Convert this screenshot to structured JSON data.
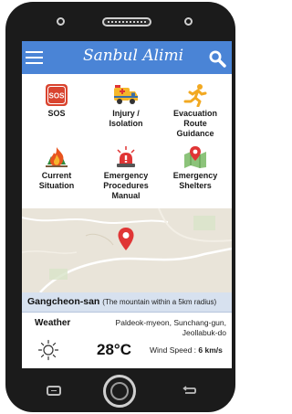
{
  "app": {
    "title": "Sanbul Alimi"
  },
  "icons": {
    "menu": "hamburger-menu-icon",
    "search": "search-icon"
  },
  "menu_tiles": [
    {
      "label_lines": [
        "SOS"
      ],
      "icon": "sos-icon"
    },
    {
      "label_lines": [
        "Injury /",
        "Isolation"
      ],
      "icon": "ambulance-icon"
    },
    {
      "label_lines": [
        "Evacuation",
        "Route",
        "Guidance"
      ],
      "icon": "running-person-icon"
    },
    {
      "label_lines": [
        "Current",
        "Situation"
      ],
      "icon": "fire-icon"
    },
    {
      "label_lines": [
        "Emergency",
        "Procedures",
        "Manual"
      ],
      "icon": "alarm-siren-icon"
    },
    {
      "label_lines": [
        "Emergency",
        "Shelters"
      ],
      "icon": "map-pin-icon"
    }
  ],
  "location": {
    "name": "Gangcheon-san",
    "note": "(The mountain within a 5km radius)"
  },
  "weather": {
    "title": "Weather",
    "address_lines": [
      "Paldeok-myeon, Sunchang-gun,",
      "Jeollabuk-do"
    ],
    "temperature": "28°C",
    "wind_label": "Wind Speed : ",
    "wind_value": "6 km/s",
    "icon": "sun-icon"
  },
  "colors": {
    "appbar": "#4a84d6",
    "sos": "#d9442f",
    "fire": "#e8541e",
    "pin": "#e03535",
    "location_bar": "#d7e1ef"
  }
}
